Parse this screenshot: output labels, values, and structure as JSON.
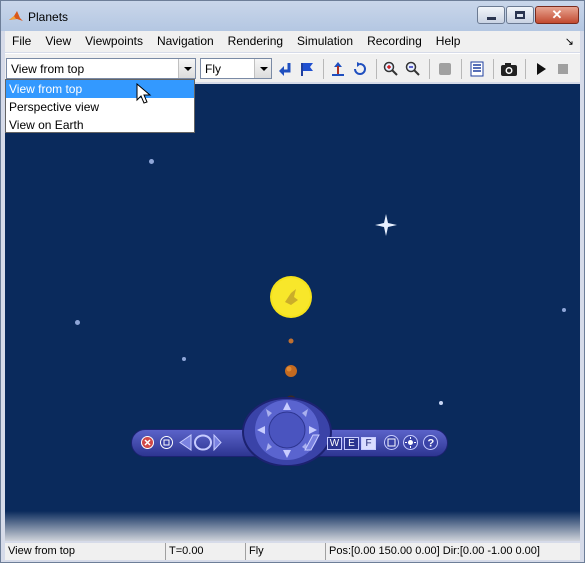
{
  "window": {
    "title": "Planets"
  },
  "menubar": {
    "items": [
      "File",
      "View",
      "Viewpoints",
      "Navigation",
      "Rendering",
      "Simulation",
      "Recording",
      "Help"
    ],
    "overflow_glyph": "↘"
  },
  "toolbar": {
    "viewpoint_value": "View from top",
    "navmode_value": "Fly",
    "icons": [
      "return-arrow-icon",
      "flag-icon",
      "straighten-up-icon",
      "undo-move-icon",
      "zoom-in-icon",
      "zoom-out-icon",
      "record-icon",
      "list-icon",
      "camera-icon",
      "play-icon",
      "stop-icon"
    ]
  },
  "viewpoint_dropdown": {
    "options": [
      "View from top",
      "Perspective view",
      "View on Earth"
    ],
    "selected_index": 0
  },
  "navpanel": {
    "letters": [
      "W",
      "E",
      "F"
    ],
    "help_glyph": "?"
  },
  "statusbar": {
    "viewpoint": "View  from top",
    "time": "T=0.00",
    "mode": "Fly",
    "position": "Pos:[0.00 150.00 0.00] Dir:[0.00 -1.00 0.00]"
  },
  "colors": {
    "background": "#0a2a5c",
    "sun": "#f5e21a",
    "selection": "#3399ff"
  }
}
